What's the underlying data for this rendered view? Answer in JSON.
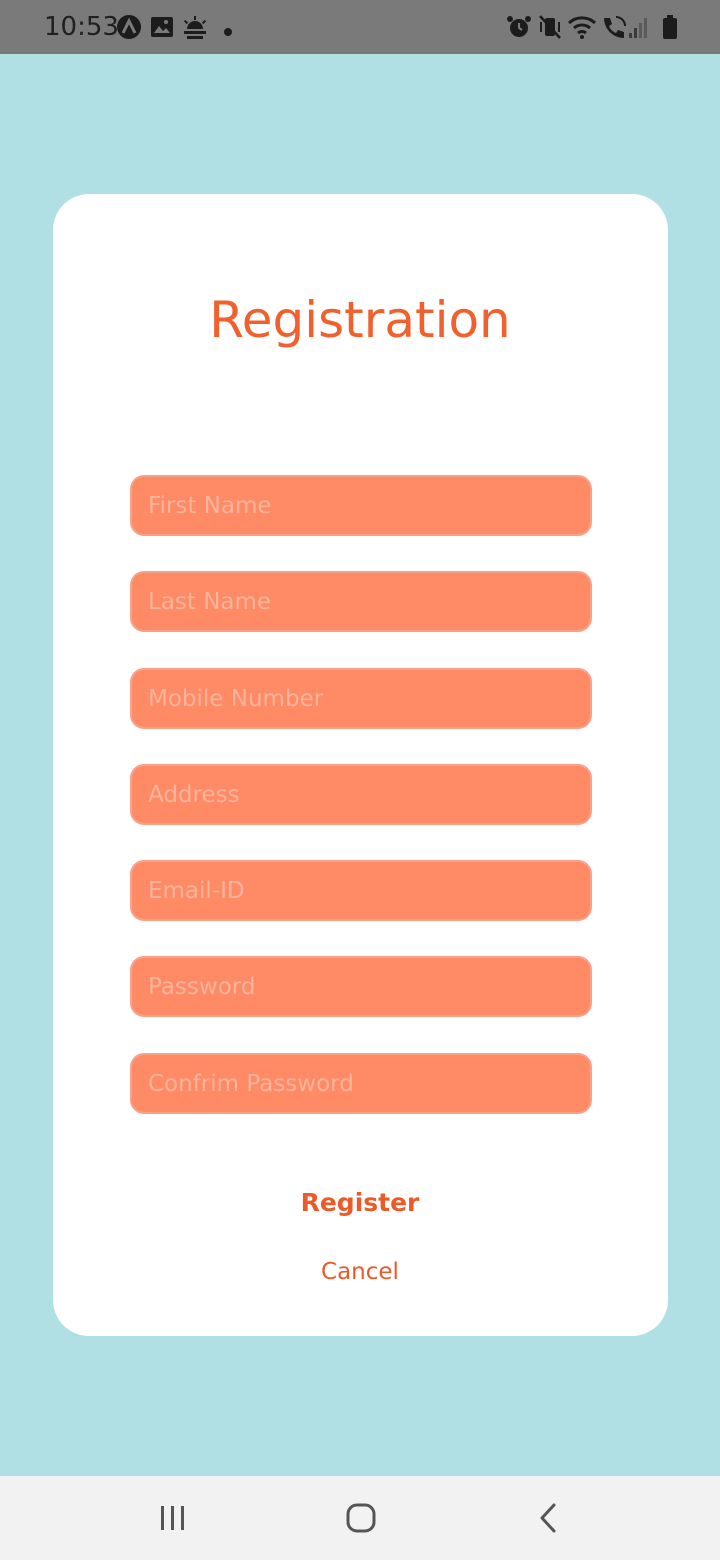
{
  "status_bar": {
    "time": "10:53",
    "left_icons": [
      "app-a-icon",
      "image-icon",
      "weather-icon",
      "dot-icon"
    ],
    "right_icons": [
      "alarm-icon",
      "vibrate-mute-icon",
      "wifi-icon",
      "wifi-calling-icon",
      "signal-icon",
      "battery-icon"
    ]
  },
  "form": {
    "title": "Registration",
    "fields": [
      {
        "placeholder": "First Name",
        "value": ""
      },
      {
        "placeholder": "Last Name",
        "value": ""
      },
      {
        "placeholder": "Mobile Number",
        "value": ""
      },
      {
        "placeholder": "Address",
        "value": ""
      },
      {
        "placeholder": "Email-ID",
        "value": ""
      },
      {
        "placeholder": "Password",
        "value": ""
      },
      {
        "placeholder": "Confrim Password",
        "value": ""
      }
    ],
    "register_label": "Register",
    "cancel_label": "Cancel"
  },
  "nav_bar": {
    "buttons": [
      "recent-apps-icon",
      "home-icon",
      "back-icon"
    ]
  },
  "colors": {
    "background": "#b0dfe4",
    "card": "#ffffff",
    "accent": "#f0612e",
    "field_fill": "#ff8a66",
    "status_bar": "#7a7a7a",
    "nav_bar": "#f2f2f2"
  }
}
